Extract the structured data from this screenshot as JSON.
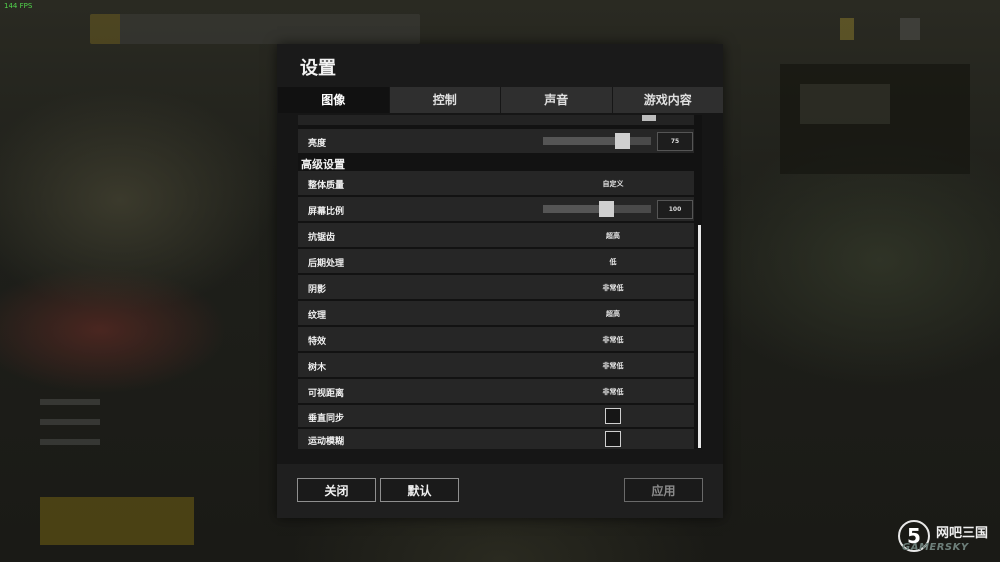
{
  "fps_text": "144 FPS",
  "window": {
    "title": "设置"
  },
  "tabs": [
    {
      "label": "图像",
      "active": true
    },
    {
      "label": "控制",
      "active": false
    },
    {
      "label": "声音",
      "active": false
    },
    {
      "label": "游戏内容",
      "active": false
    }
  ],
  "brightness": {
    "label": "亮度",
    "value": "75",
    "slider_fraction": 0.73
  },
  "advanced": {
    "section_title": "高级设置",
    "overall_quality": {
      "label": "整体质量",
      "value": "自定义"
    },
    "screen_scale": {
      "label": "屏幕比例",
      "value": "100",
      "slider_fraction": 0.58
    },
    "anti_aliasing": {
      "label": "抗锯齿",
      "value": "超高"
    },
    "post_processing": {
      "label": "后期处理",
      "value": "低"
    },
    "shadows": {
      "label": "阴影",
      "value": "非常低"
    },
    "textures": {
      "label": "纹理",
      "value": "超高"
    },
    "effects": {
      "label": "特效",
      "value": "非常低"
    },
    "foliage": {
      "label": "树木",
      "value": "非常低"
    },
    "view_distance": {
      "label": "可视距离",
      "value": "非常低"
    },
    "vsync": {
      "label": "垂直同步",
      "checked": false
    },
    "motion_blur": {
      "label": "运动模糊",
      "checked": false
    }
  },
  "footer": {
    "close_label": "关闭",
    "default_label": "默认",
    "apply_label": "应用"
  },
  "watermark": {
    "digit": "5",
    "cn_text": "网吧三国",
    "en_text": "GAMERSKY"
  },
  "colors": {
    "accent_fps": "#52d44c",
    "panel_bg": "#161616",
    "row_bg": "#262626"
  }
}
